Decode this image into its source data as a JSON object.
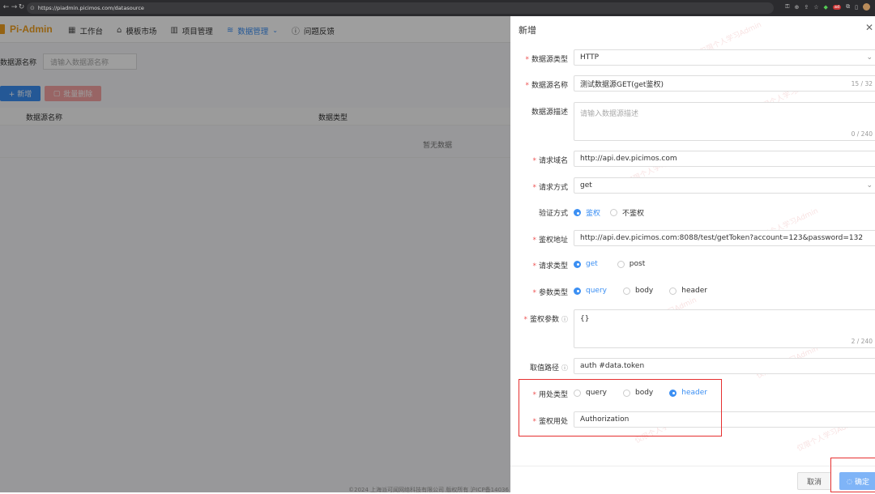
{
  "browser": {
    "url": "https://piadmin.picimos.com/datasource"
  },
  "app": {
    "logo": "Pi-Admin",
    "menu": [
      {
        "label": "工作台",
        "icon": "grid-icon"
      },
      {
        "label": "模板市场",
        "icon": "shop-icon"
      },
      {
        "label": "项目管理",
        "icon": "chart-icon"
      },
      {
        "label": "数据管理",
        "icon": "database-icon"
      },
      {
        "label": "问题反馈",
        "icon": "info-icon"
      }
    ],
    "search_label": "数据源名称",
    "search_placeholder": "请输入数据源名称",
    "add_button": "+ 新增",
    "batch_delete_button": "批量删除",
    "table_headers": [
      "数据源名称",
      "数据类型"
    ],
    "empty_text": "暂无数据",
    "footer": "©2024 上海派可闻网络科技有限公司 版权所有 沪ICP备14036"
  },
  "drawer": {
    "title": "新增",
    "datasource_type": {
      "label": "数据源类型",
      "value": "HTTP"
    },
    "datasource_name": {
      "label": "数据源名称",
      "value": "测试数据源GET(get鉴权)",
      "count": "15 / 32"
    },
    "datasource_desc": {
      "label": "数据源描述",
      "placeholder": "请输入数据源描述",
      "count": "0 / 240"
    },
    "request_domain": {
      "label": "请求域名",
      "value": "http://api.dev.picimos.com"
    },
    "request_method": {
      "label": "请求方式",
      "value": "get"
    },
    "auth_mode": {
      "label": "验证方式",
      "options": [
        "鉴权",
        "不鉴权"
      ]
    },
    "auth_url": {
      "label": "鉴权地址",
      "value": "http://api.dev.picimos.com:8088/test/getToken?account=123&password=132"
    },
    "request_type": {
      "label": "请求类型",
      "options": [
        "get",
        "post"
      ]
    },
    "param_type": {
      "label": "参数类型",
      "options": [
        "query",
        "body",
        "header"
      ]
    },
    "auth_params": {
      "label": "鉴权参数",
      "value": "{}",
      "count": "2 / 240"
    },
    "value_path": {
      "label": "取值路径",
      "value": "auth #data.token"
    },
    "usage_type": {
      "label": "用处类型",
      "options": [
        "query",
        "body",
        "header"
      ]
    },
    "auth_usage": {
      "label": "鉴权用处",
      "value": "Authorization"
    },
    "cancel": "取消",
    "confirm": "确定"
  },
  "colors": {
    "accent": "#3b8ff3",
    "logo": "#f0a020",
    "highlight": "#e63030"
  }
}
